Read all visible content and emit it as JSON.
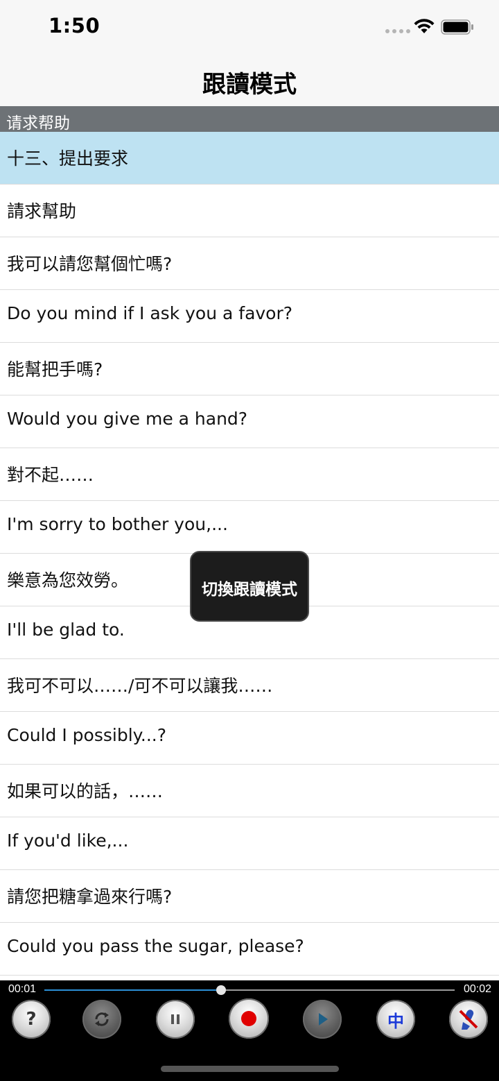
{
  "status_bar": {
    "time": "1:50"
  },
  "nav": {
    "title": "跟讀模式"
  },
  "section": {
    "header": "请求帮助"
  },
  "list": {
    "items": [
      "十三、提出要求",
      "請求幫助",
      "我可以請您幫個忙嗎?",
      "Do you mind if I ask you a favor?",
      "能幫把手嗎?",
      "Would you give me a hand?",
      "對不起……",
      "I'm sorry to bother you,...",
      "樂意為您效勞。",
      "I'll be glad to.",
      "我可不可以……/可不可以讓我……",
      "Could I possibly...?",
      "如果可以的話，……",
      "If you'd like,...",
      "請您把糖拿過來行嗎?",
      "Could you pass the sugar, please?"
    ],
    "active_index": 0
  },
  "toast": {
    "text": "切換跟讀模式"
  },
  "player": {
    "current_time": "00:01",
    "total_time": "00:02",
    "progress_fraction": 0.43,
    "buttons": {
      "help_glyph": "?",
      "lang_glyph": "中"
    }
  },
  "colors": {
    "active_row": "#bee2f2",
    "section_header": "#6d7276",
    "progress": "#2b8fd6",
    "record": "#e00000"
  }
}
